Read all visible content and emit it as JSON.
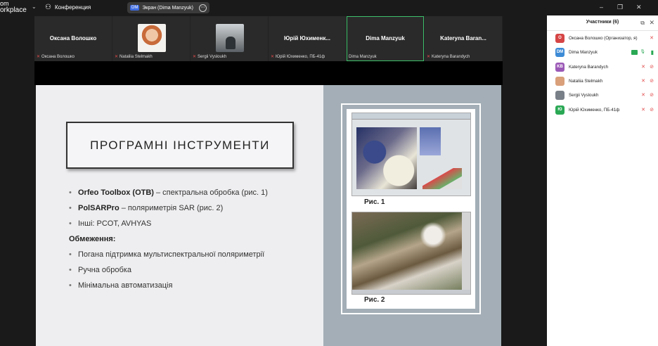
{
  "app": {
    "brand_line1": "om",
    "brand_line2": "orkplace"
  },
  "topbar": {
    "conference_label": "Конференция",
    "share_badge": "DM",
    "share_label": "Экран (Dima Manzyuk)"
  },
  "video_tiles": [
    {
      "display_name": "Оксана Волошко",
      "label": "Оксана Волошко",
      "has_photo": false,
      "active": false
    },
    {
      "display_name": "",
      "label": "Nataliia Stelmakh",
      "has_photo": true,
      "active": false
    },
    {
      "display_name": "",
      "label": "Sergii Vysloukh",
      "has_photo": true,
      "active": false
    },
    {
      "display_name": "Юрій Юхименк...",
      "label": "Юрій Юхименко, ПБ-41ф",
      "has_photo": false,
      "active": false
    },
    {
      "display_name": "Dima Manzyuk",
      "label": "Dima Manzyuk",
      "has_photo": false,
      "active": true
    },
    {
      "display_name": "Kateryna Baran...",
      "label": "Kateryna Barandych",
      "has_photo": false,
      "active": false
    }
  ],
  "slide": {
    "title": "ПРОГРАМНІ ІНСТРУМЕНТИ",
    "bullet1_bold": "Orfeo Toolbox (OTB)",
    "bullet1_rest": " – спектральна обробка (рис. 1)",
    "bullet2_bold": "PolSARPro",
    "bullet2_rest": " – поляриметрія SAR (рис. 2)",
    "bullet3": "Інші: PCOT, AVHYAS",
    "limits_heading": "Обмеження:",
    "limit1": "Погана підтримка мультиспектральної поляриметрії",
    "limit2": "Ручна обробка",
    "limit3": "Мінімальна автоматизація",
    "caption1": "Рис. 1",
    "caption2": "Рис. 2"
  },
  "participants_panel": {
    "title": "Участники (6)",
    "participants": [
      {
        "initials": "О",
        "name": "Оксана Волошко (Организатор, я)",
        "color": "#d64545",
        "mic": "muted",
        "cam": "none"
      },
      {
        "initials": "DM",
        "name": "Dima Manzyuk",
        "color": "#3d8bd6",
        "mic": "on",
        "cam": "on"
      },
      {
        "initials": "KB",
        "name": "Kateryna Barandych",
        "color": "#9b59b6",
        "mic": "muted",
        "cam": "off"
      },
      {
        "initials": "",
        "name": "Nataliia Stelmakh",
        "color": "#d9a07a",
        "mic": "muted",
        "cam": "off"
      },
      {
        "initials": "",
        "name": "Sergii Vysloukh",
        "color": "#7a8088",
        "mic": "muted",
        "cam": "off"
      },
      {
        "initials": "Ю",
        "name": "Юрій Юхименко, ПБ-41ф",
        "color": "#2aa854",
        "mic": "muted",
        "cam": "off"
      }
    ]
  }
}
